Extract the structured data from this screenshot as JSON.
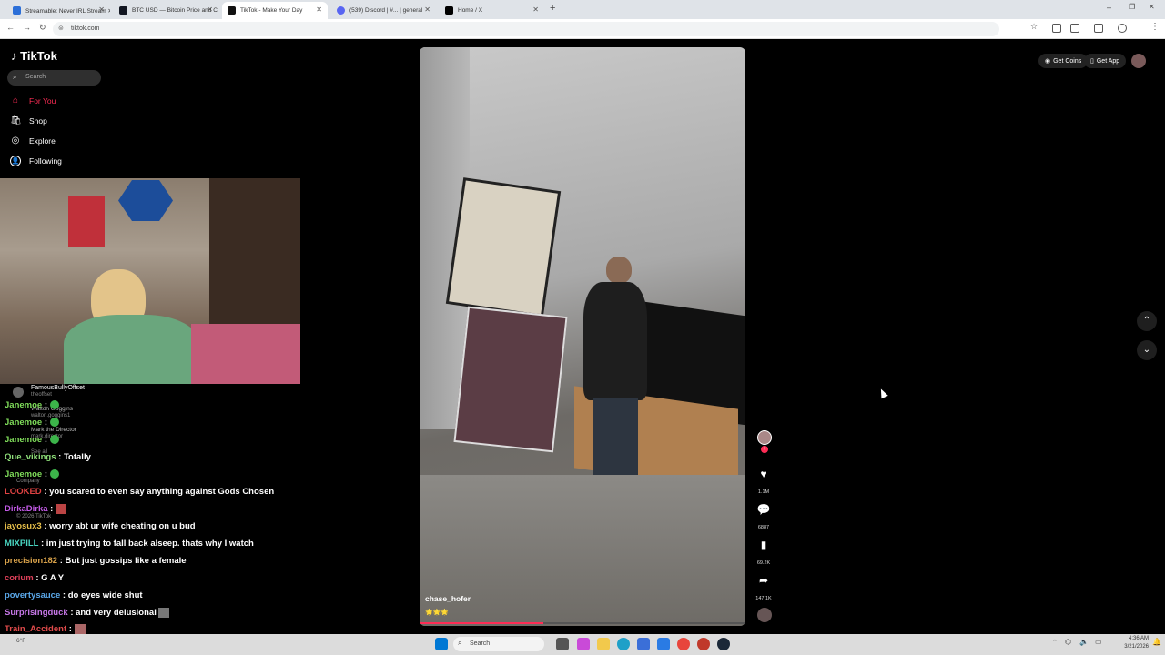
{
  "browser": {
    "tabs": [
      {
        "label": "Streamable: Never IRL Stream ✕",
        "favicon_color": "#2c6fd8"
      },
      {
        "label": "BTC USD — Bitcoin Price and C",
        "favicon_color": "#131722"
      },
      {
        "label": "TikTok - Make Your Day",
        "favicon_color": "#111111",
        "active": true
      },
      {
        "label": "(539) Discord | #... | general",
        "favicon_color": "#5865f2"
      },
      {
        "label": "Home / X",
        "favicon_color": "#000000"
      }
    ],
    "url": "tiktok.com"
  },
  "tiktok": {
    "logo": "TikTok",
    "search_placeholder": "Search",
    "nav": [
      {
        "label": "For You",
        "icon": "home-icon",
        "active": true
      },
      {
        "label": "Shop",
        "icon": "shop-icon"
      },
      {
        "label": "Explore",
        "icon": "compass-icon"
      },
      {
        "label": "Following",
        "icon": "following-icon"
      }
    ],
    "following_accounts": [
      {
        "name": "FamousBullyOffset",
        "handle": "theoffset"
      },
      {
        "name": "Walton Goggins",
        "handle": "walton.goggins1"
      },
      {
        "name": "Mark the Director",
        "handle": "mark.director"
      }
    ],
    "sidebar_footer": {
      "see_all": "See all",
      "company": "Company",
      "copyright": "© 2026 TikTok"
    },
    "top_buttons": {
      "get_coins": "Get Coins",
      "get_app": "Get App"
    },
    "video": {
      "username": "chase_hofer",
      "caption": "🌟🌟🌟",
      "progress": 0.38
    },
    "rail": {
      "likes": "1.1M",
      "comments": "6887",
      "saves": "69.2K",
      "shares": "147.1K"
    }
  },
  "chat": [
    {
      "user": "Janemoe",
      "msg": "",
      "color": "#7fdc5a"
    },
    {
      "user": "Janemoe",
      "msg": "",
      "color": "#7fdc5a"
    },
    {
      "user": "Janemoe",
      "msg": "",
      "color": "#7fdc5a"
    },
    {
      "user": "Que_vikings",
      "msg": "Totally",
      "color": "#8fe07a"
    },
    {
      "user": "Janemoe",
      "msg": "",
      "color": "#7fdc5a"
    },
    {
      "user": "LOOKED",
      "msg": "you scared to even say anything against Gods Chosen",
      "color": "#e04343"
    },
    {
      "user": "DirkaDirka",
      "msg": "",
      "color": "#c45be8"
    },
    {
      "user": "jayosux3",
      "msg": "worry abt ur wife cheating on u bud",
      "color": "#e8c04a"
    },
    {
      "user": "MIXPILL",
      "msg": "im just trying to fall back alseep. thats why I watch",
      "color": "#49d6c2"
    },
    {
      "user": "precision182",
      "msg": "But just gossips like a female",
      "color": "#d9a24a"
    },
    {
      "user": "corium",
      "msg": "G A Y",
      "color": "#e0405a"
    },
    {
      "user": "povertysauce",
      "msg": "do eyes wide shut",
      "color": "#5aa7e8"
    },
    {
      "user": "Surprisingduck",
      "msg": "and very delusional",
      "color": "#c778e8"
    },
    {
      "user": "Train_Accident",
      "msg": "",
      "color": "#e04b4b"
    }
  ],
  "taskbar": {
    "search": "Search",
    "time": "4:36 AM",
    "date": "3/21/2026",
    "weather": "6°F"
  }
}
